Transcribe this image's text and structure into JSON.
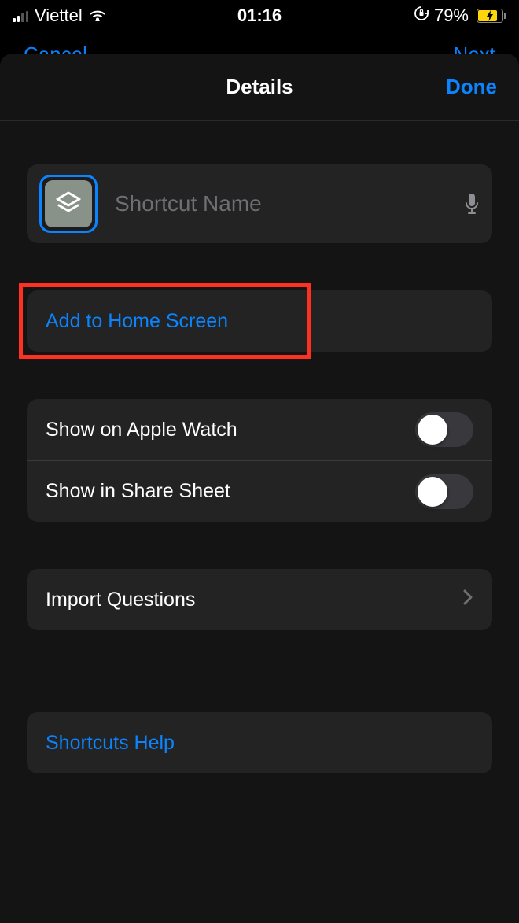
{
  "status": {
    "carrier": "Viettel",
    "time": "01:16",
    "battery_pct": "79%",
    "battery_fill_pct": 79
  },
  "background_nav": {
    "left": "Cancel",
    "right": "Next"
  },
  "sheet": {
    "title": "Details",
    "done": "Done",
    "shortcut_name_placeholder": "Shortcut Name",
    "add_to_home": "Add to Home Screen",
    "show_watch": "Show on Apple Watch",
    "show_share": "Show in Share Sheet",
    "import_questions": "Import Questions",
    "shortcuts_help": "Shortcuts Help",
    "toggles": {
      "watch_on": false,
      "share_on": false
    }
  }
}
